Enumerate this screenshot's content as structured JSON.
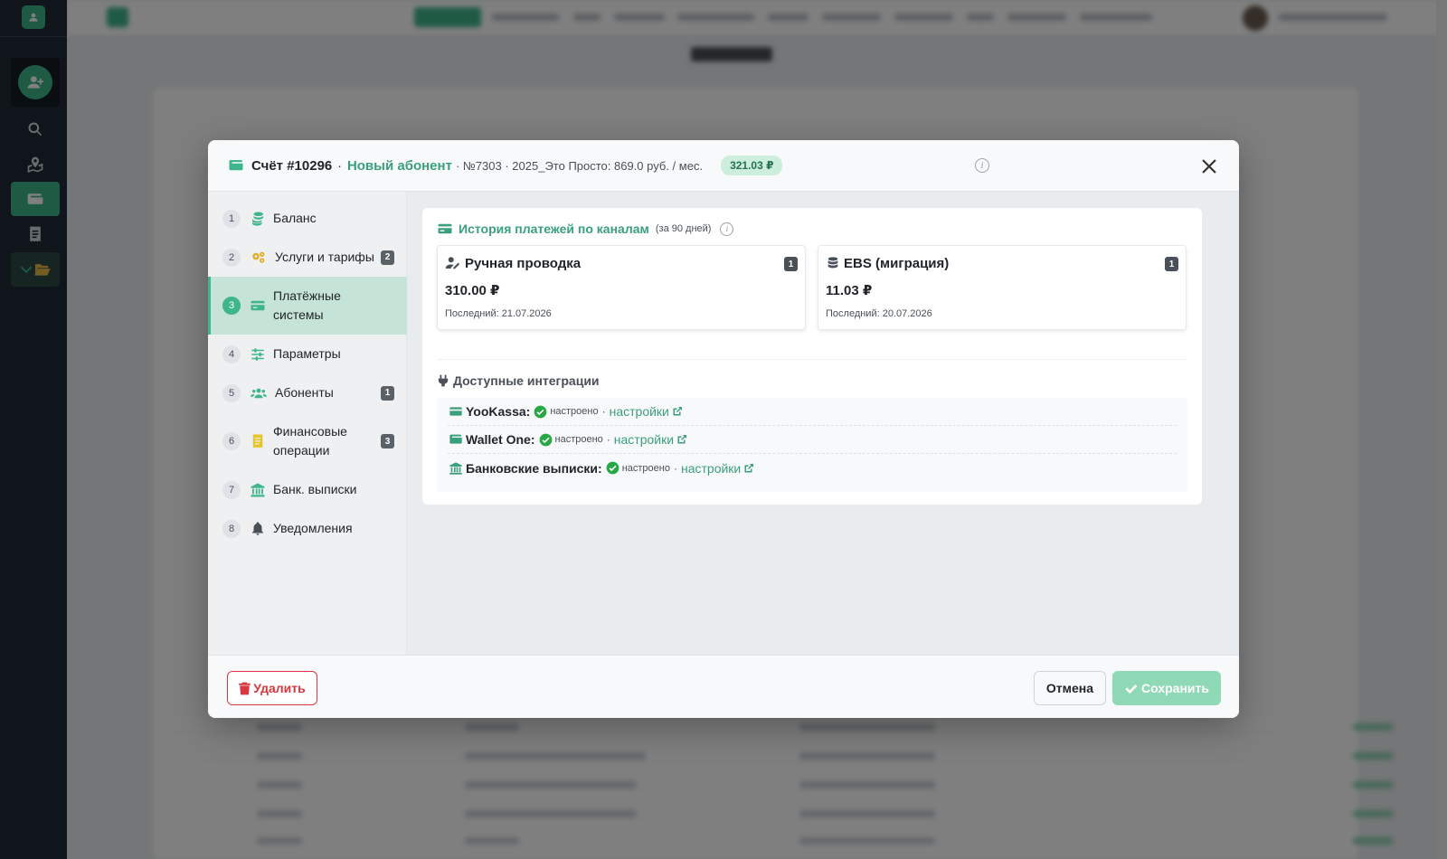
{
  "colors": {
    "brand": "#3fb58b",
    "brand_text": "#3a9f7b",
    "danger": "#d9363e",
    "sidebar_bg": "#212b36"
  },
  "modal": {
    "title": "Счёт #10296",
    "separator": "·",
    "subscriber": "Новый абонент",
    "meta": "· №7303 · 2025_Это Просто: 869.0 руб. / мес.",
    "balance_badge": "321.03 ₽",
    "info_icon": "info-circle-icon",
    "close_icon": "close-icon"
  },
  "steps": [
    {
      "num": "1",
      "label": "Баланс",
      "icon": "coins-icon",
      "count": ""
    },
    {
      "num": "2",
      "label": "Услуги и тарифы",
      "icon": "cogs-icon",
      "count": "2"
    },
    {
      "num": "3",
      "label": "Платёжные системы",
      "icon": "credit-card-icon",
      "count": "",
      "active": true
    },
    {
      "num": "4",
      "label": "Параметры",
      "icon": "sliders-icon",
      "count": ""
    },
    {
      "num": "5",
      "label": "Абоненты",
      "icon": "users-icon",
      "count": "1"
    },
    {
      "num": "6",
      "label": "Финансовые операции",
      "icon": "receipt-icon",
      "count": "3"
    },
    {
      "num": "7",
      "label": "Банк. выписки",
      "icon": "bank-icon",
      "count": ""
    },
    {
      "num": "8",
      "label": "Уведомления",
      "icon": "bell-icon",
      "count": ""
    }
  ],
  "history": {
    "title": "История платежей по каналам",
    "period": "(за 90 дней)",
    "channels": [
      {
        "name": "Ручная проводка",
        "icon": "user-edit-icon",
        "count": "1",
        "amount": "310.00 ₽",
        "last": "Последний: 21.07.2026"
      },
      {
        "name": "EBS (миграция)",
        "icon": "database-icon",
        "count": "1",
        "amount": "11.03 ₽",
        "last": "Последний: 20.07.2026"
      }
    ]
  },
  "integrations": {
    "title": "Доступные интеграции",
    "items": [
      {
        "name": "YooKassa:",
        "status": "настроено",
        "dot": "·",
        "link": "настройки"
      },
      {
        "name": "Wallet One:",
        "status": "настроено",
        "dot": "·",
        "link": "настройки"
      },
      {
        "name": "Банковские выписки:",
        "status": "настроено",
        "dot": "·",
        "link": "настройки"
      }
    ]
  },
  "footer": {
    "delete_label": "Удалить",
    "cancel_label": "Отмена",
    "save_label": "Сохранить"
  }
}
